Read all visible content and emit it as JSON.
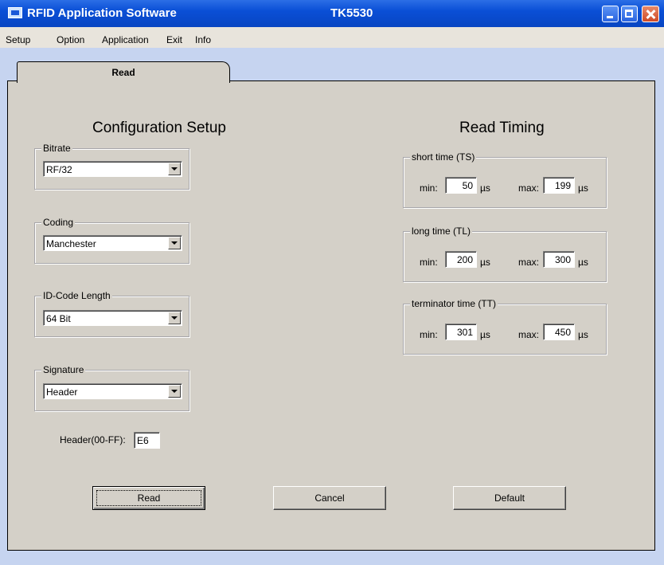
{
  "window": {
    "title": "RFID Application Software",
    "model": "TK5530"
  },
  "menu": [
    "Setup",
    "Option",
    "Application",
    "Exit",
    "Info"
  ],
  "tabs": [
    {
      "label": "Read",
      "active": true
    }
  ],
  "config": {
    "title": "Configuration Setup",
    "bitrate": {
      "label": "Bitrate",
      "value": "RF/32"
    },
    "coding": {
      "label": "Coding",
      "value": "Manchester"
    },
    "id_length": {
      "label": "ID-Code Length",
      "value": "64 Bit"
    },
    "signature": {
      "label": "Signature",
      "value": "Header"
    },
    "header": {
      "label": "Header(00-FF):",
      "value": "E6"
    }
  },
  "timing": {
    "title": "Read Timing",
    "min_label": "min:",
    "max_label": "max:",
    "unit": "µs",
    "short": {
      "label": "short time (TS)",
      "min": "50",
      "max": "199"
    },
    "long": {
      "label": "long time (TL)",
      "min": "200",
      "max": "300"
    },
    "terminator": {
      "label": "terminator time (TT)",
      "min": "301",
      "max": "450"
    }
  },
  "buttons": {
    "read": "Read",
    "cancel": "Cancel",
    "default": "Default"
  }
}
